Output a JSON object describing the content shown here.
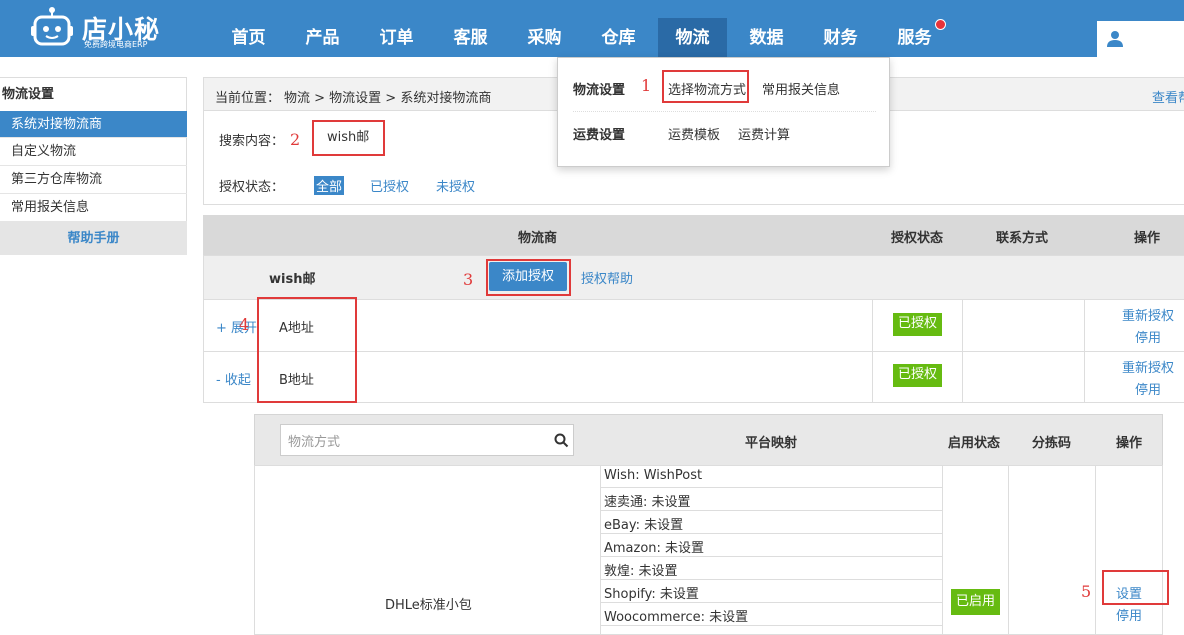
{
  "brand": {
    "name": "店小秘",
    "tagline": "免费跨境电商ERP"
  },
  "nav": {
    "items": [
      "首页",
      "产品",
      "订单",
      "客服",
      "采购",
      "仓库",
      "物流",
      "数据",
      "财务",
      "服务"
    ],
    "active_index": 6
  },
  "sidebar": {
    "title": "物流设置",
    "items": [
      {
        "label": "系统对接物流商",
        "active": true
      },
      {
        "label": "自定义物流",
        "active": false
      },
      {
        "label": "第三方仓库物流",
        "active": false
      },
      {
        "label": "常用报关信息",
        "active": false
      }
    ],
    "help": "帮助手册"
  },
  "breadcrumb": {
    "prefix": "当前位置：",
    "path": "物流 > 物流设置 > 系统对接物流商",
    "view_link": "查看帮"
  },
  "search": {
    "label": "搜索内容：",
    "value": "wish邮"
  },
  "auth_filter": {
    "label": "授权状态：",
    "options": [
      "全部",
      "已授权",
      "未授权"
    ],
    "active_index": 0
  },
  "dropdown": {
    "group1": {
      "title": "物流设置",
      "items": [
        "选择物流方式",
        "常用报关信息"
      ]
    },
    "group2": {
      "title": "运费设置",
      "items": [
        "运费模板",
        "运费计算"
      ]
    }
  },
  "carrier_table": {
    "headers": [
      "物流商",
      "授权状态",
      "联系方式",
      "操作"
    ],
    "carrier_name": "wish邮",
    "add_auth": "添加授权",
    "auth_help": "授权帮助",
    "rows": [
      {
        "toggle": "+ 展开",
        "name": "A地址",
        "status": "已授权",
        "actions": [
          "重新授权",
          "停用"
        ]
      },
      {
        "toggle": "- 收起",
        "name": "B地址",
        "status": "已授权",
        "actions": [
          "重新授权",
          "停用"
        ]
      }
    ]
  },
  "method_table": {
    "search_placeholder": "物流方式",
    "headers": [
      "平台映射",
      "启用状态",
      "分拣码",
      "操作"
    ],
    "method": "DHLe标准小包",
    "mappings": [
      "Wish:   WishPost",
      "速卖通:  未设置",
      "eBay:  未设置",
      "Amazon:  未设置",
      "敦煌:  未设置",
      "Shopify:  未设置",
      "Woocommerce:  未设置"
    ],
    "status": "已启用",
    "actions": [
      "设置",
      "停用"
    ]
  },
  "annotations": [
    "1",
    "2",
    "3",
    "4",
    "5"
  ],
  "colors": {
    "primary": "#3b87c8",
    "active_nav": "#2a6aa6",
    "success": "#66bb11",
    "annotation": "#e03a3a"
  }
}
